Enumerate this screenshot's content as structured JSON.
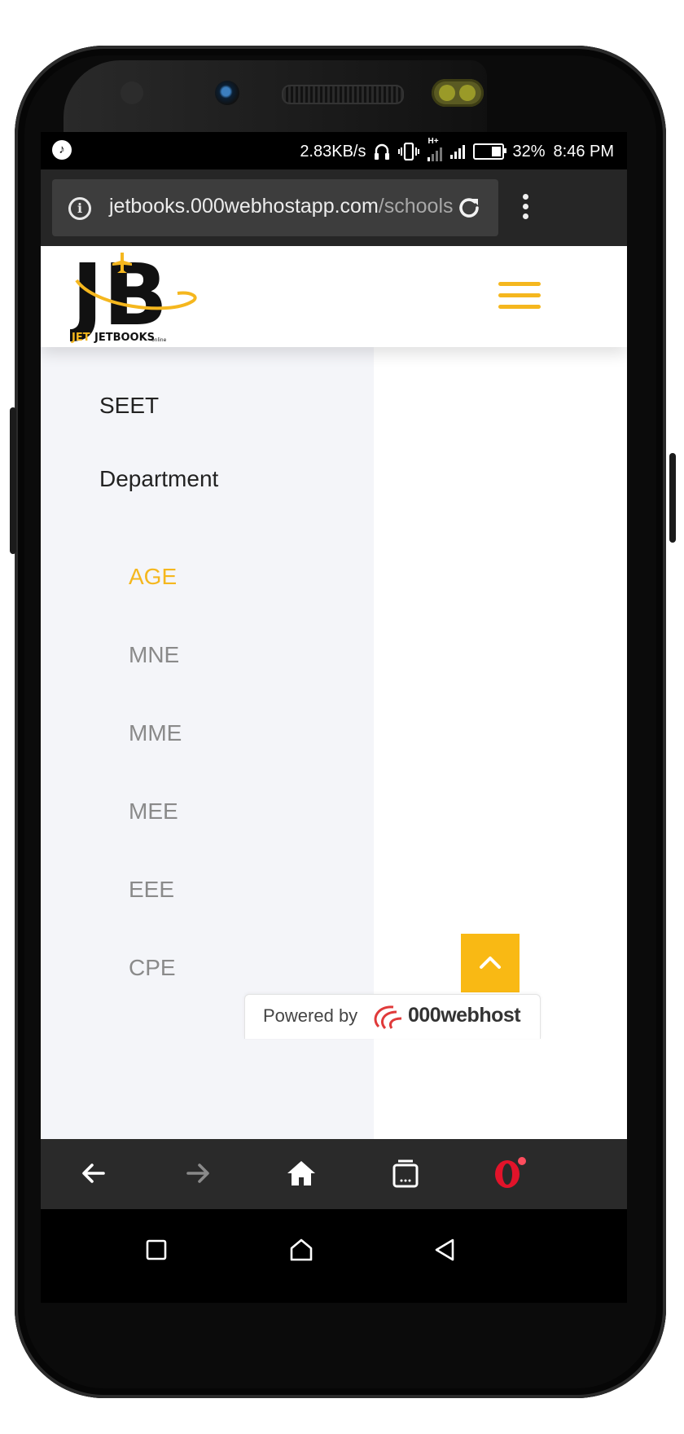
{
  "status_bar": {
    "speed": "2.83KB/s",
    "network": "H+",
    "battery_percent": "32%",
    "time": "8:46 PM"
  },
  "browser": {
    "url_domain": "jetbooks.000webhostapp.com",
    "url_path": "/schools"
  },
  "site": {
    "logo_text": "JB",
    "logo_brand": "JETBOOKS",
    "logo_suffix": "online"
  },
  "sidebar": {
    "school": "SEET",
    "section_label": "Department",
    "departments": [
      {
        "label": "AGE",
        "active": true
      },
      {
        "label": "MNE",
        "active": false
      },
      {
        "label": "MME",
        "active": false
      },
      {
        "label": "MEE",
        "active": false
      },
      {
        "label": "EEE",
        "active": false
      },
      {
        "label": "CPE",
        "active": false
      }
    ]
  },
  "footer_badge": {
    "powered_by": "Powered by",
    "brand": "000webhost"
  },
  "bottom_nav": {
    "items": [
      "back-icon",
      "forward-icon",
      "home-icon",
      "tabs-icon",
      "opera-icon"
    ]
  },
  "system_nav": {
    "items": [
      "recents-icon",
      "home-icon",
      "back-icon"
    ]
  },
  "colors": {
    "accent": "#f5b71e",
    "sidebar_bg": "#f4f5f9",
    "browser_bar": "#262626"
  }
}
